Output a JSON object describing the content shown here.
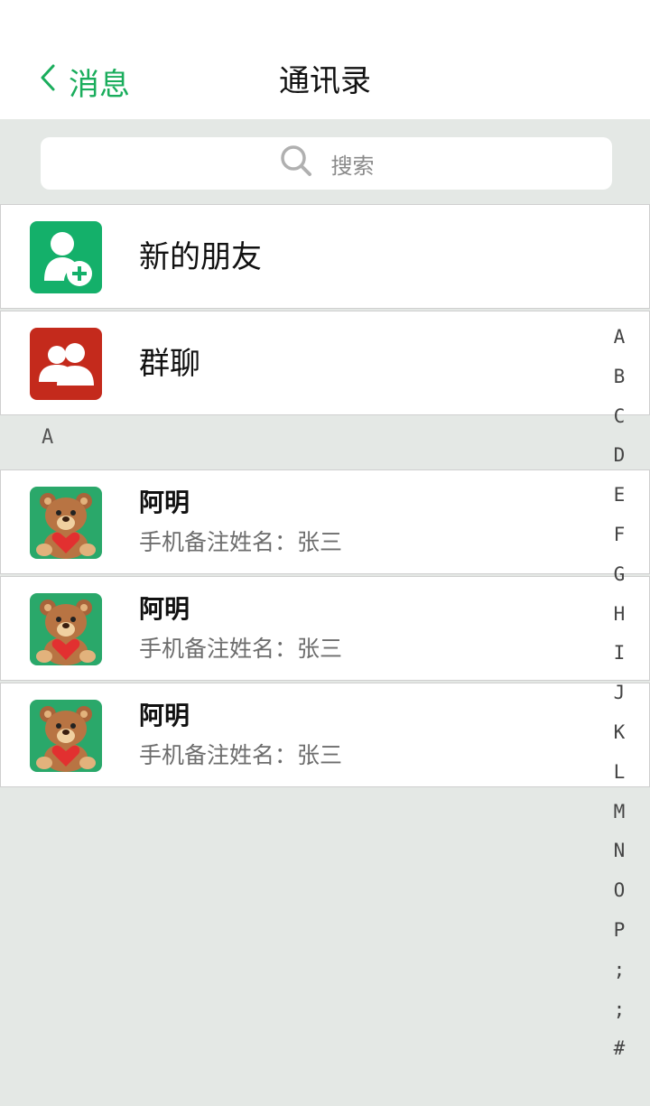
{
  "nav": {
    "back_label": "消息",
    "title": "通讯录"
  },
  "search": {
    "placeholder": "搜索"
  },
  "entries": {
    "new_friends": "新的朋友",
    "group_chat": "群聊"
  },
  "section_letter": "A",
  "contacts": [
    {
      "name": "阿明",
      "remark": "手机备注姓名：张三"
    },
    {
      "name": "阿明",
      "remark": "手机备注姓名：张三"
    },
    {
      "name": "阿明",
      "remark": "手机备注姓名：张三"
    }
  ],
  "index_letters": [
    "A",
    "B",
    "C",
    "D",
    "E",
    "F",
    "G",
    "H",
    "I",
    "J",
    "K",
    "L",
    "M",
    "N",
    "O",
    "P",
    ";",
    ";",
    "#"
  ],
  "colors": {
    "accent": "#1aad5c",
    "new_friends_bg": "#14b06a",
    "group_chat_bg": "#c42a1c",
    "background": "#e4e8e5"
  }
}
